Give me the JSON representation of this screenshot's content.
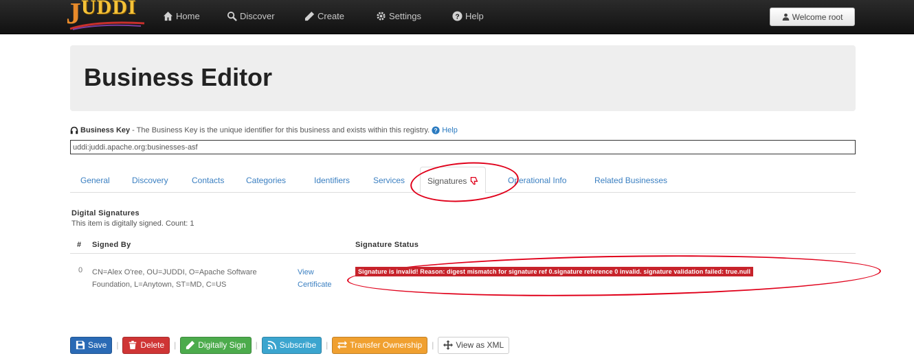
{
  "brand": {
    "logo_text": "UDDI",
    "logo_initial": "J"
  },
  "nav": {
    "items": [
      {
        "label": "Home",
        "icon": "home-icon"
      },
      {
        "label": "Discover",
        "icon": "search-icon"
      },
      {
        "label": "Create",
        "icon": "pencil-icon"
      },
      {
        "label": "Settings",
        "icon": "gear-icon"
      },
      {
        "label": "Help",
        "icon": "question-icon"
      }
    ],
    "welcome": "Welcome root"
  },
  "page": {
    "title": "Business Editor"
  },
  "business_key": {
    "label": "Business Key",
    "description": "- The Business Key is the unique identifier for this business and exists within this registry.",
    "help_label": "Help",
    "value": "uddi:juddi.apache.org:businesses-asf"
  },
  "tabs": [
    {
      "label": "General"
    },
    {
      "label": "Discovery"
    },
    {
      "label": "Contacts"
    },
    {
      "label": "Categories"
    },
    {
      "label": "Identifiers"
    },
    {
      "label": "Services"
    },
    {
      "label": "Signatures",
      "active": true
    },
    {
      "label": "Operational Info"
    },
    {
      "label": "Related Businesses"
    }
  ],
  "signatures": {
    "title": "Digital Signatures",
    "count_text": "This item is digitally signed. Count: 1",
    "columns": {
      "num": "#",
      "signed_by": "Signed By",
      "status": "Signature Status"
    },
    "rows": [
      {
        "num": "0",
        "signed_by": "CN=Alex O'ree, OU=JUDDI, O=Apache Software Foundation, L=Anytown, ST=MD, C=US",
        "view_certificate": "View Certificate",
        "status": "Signature is invalid! Reason: digest mismatch for signature ref 0.signature reference 0 invalid. signature validation failed: true.null"
      }
    ]
  },
  "actions": {
    "save": "Save",
    "delete": "Delete",
    "sign": "Digitally Sign",
    "subscribe": "Subscribe",
    "transfer": "Transfer Ownership",
    "xml": "View as XML",
    "separator": "|"
  },
  "colors": {
    "navbar": "#1a1a1a",
    "link": "#3a7fc1",
    "danger": "#c7232b",
    "annotation": "#e0001a"
  }
}
